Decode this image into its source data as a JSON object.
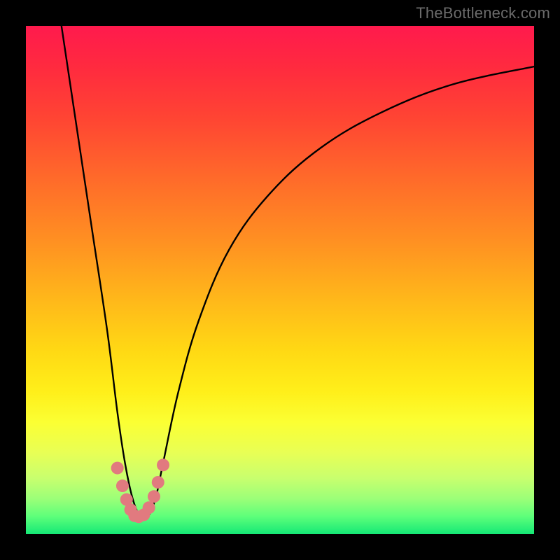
{
  "watermark": "TheBottleneck.com",
  "chart_data": {
    "type": "line",
    "title": "",
    "xlabel": "",
    "ylabel": "",
    "xlim": [
      0,
      100
    ],
    "ylim": [
      0,
      100
    ],
    "grid": false,
    "series": [
      {
        "name": "bottleneck-curve",
        "x": [
          7,
          10,
          13,
          16,
          18,
          19.5,
          21,
          22.5,
          24,
          25.5,
          27,
          30,
          34,
          40,
          48,
          58,
          70,
          84,
          100
        ],
        "values": [
          100,
          80,
          60,
          40,
          24,
          14,
          7,
          3.5,
          3.5,
          7,
          14,
          28,
          42,
          56,
          67,
          76,
          83,
          88.5,
          92
        ]
      }
    ],
    "annotations": {
      "trough_markers": {
        "color": "#e17a7f",
        "points_x": [
          18.0,
          19.0,
          19.8,
          20.6,
          21.4,
          22.2,
          23.2,
          24.2,
          25.2,
          26.0,
          27.0
        ],
        "points_y": [
          13.0,
          9.5,
          6.8,
          4.8,
          3.6,
          3.4,
          3.8,
          5.2,
          7.4,
          10.2,
          13.6
        ]
      }
    }
  }
}
